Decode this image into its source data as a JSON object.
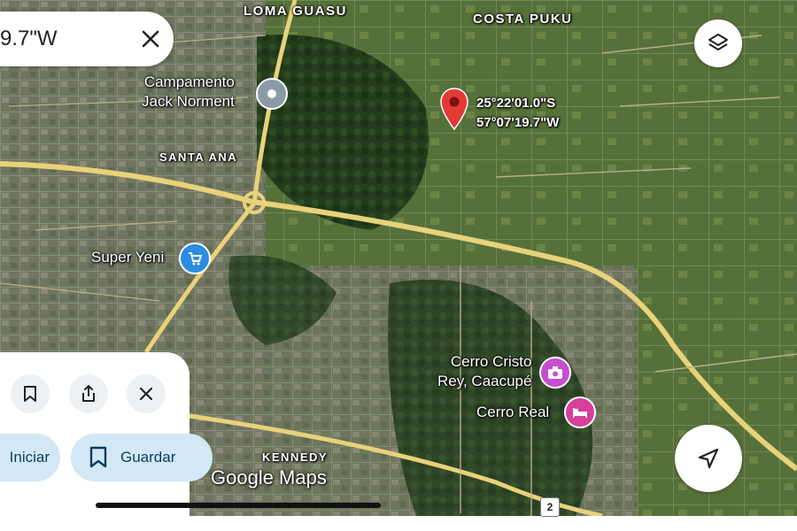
{
  "search": {
    "query_fragment": "9.7\"W"
  },
  "map": {
    "type": "satellite",
    "area_labels": [
      "LOMA GUASU",
      "COSTA PUKU",
      "SANTA ANA",
      "KENNEDY"
    ],
    "pois": [
      {
        "name_line1": "Campamento",
        "name_line2": "Jack Norment",
        "icon": "landmark-pin-icon",
        "color": "#8a9aa6"
      },
      {
        "name": "Super Yeni",
        "icon": "shopping-cart-icon",
        "color": "#2b8de0"
      },
      {
        "name_line1": "Cerro Cristo",
        "name_line2": "Rey, Caacupé",
        "icon": "camera-icon",
        "color": "#c64fd1"
      },
      {
        "name": "Cerro Real",
        "icon": "bed-icon",
        "color": "#d63f9a"
      }
    ],
    "dropped_pin": {
      "lat": "25°22'01.0\"S",
      "lng": "57°07'19.7\"W",
      "color": "#e53935"
    },
    "route_shield": "2",
    "watermark": "Google Maps"
  },
  "panel": {
    "start_label": "Iniciar",
    "save_label": "Guardar"
  },
  "colors": {
    "road": "#e8d27a",
    "pill_bg": "#d3e8f6",
    "accent": "#0b3c5d"
  }
}
